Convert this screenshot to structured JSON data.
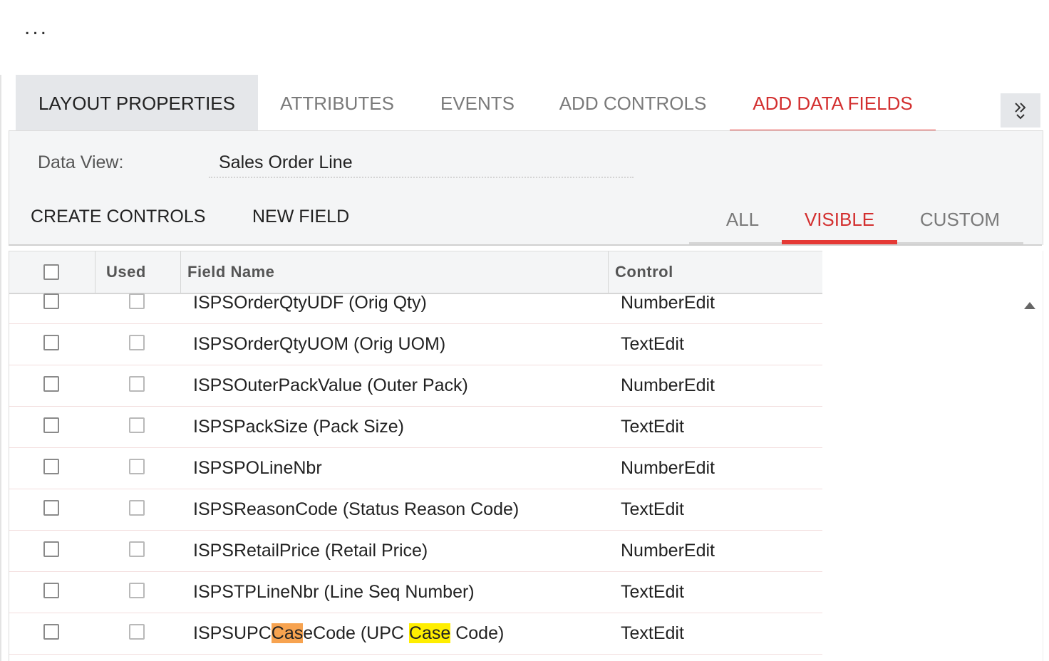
{
  "header": {
    "more_menu": "..."
  },
  "tabs": [
    {
      "label": "LAYOUT PROPERTIES"
    },
    {
      "label": "ATTRIBUTES"
    },
    {
      "label": "EVENTS"
    },
    {
      "label": "ADD CONTROLS"
    },
    {
      "label": "ADD DATA FIELDS"
    }
  ],
  "expand_icon": "double-chevron-icon",
  "data_view": {
    "label": "Data View:",
    "value": "Sales Order Line"
  },
  "actions": {
    "create_controls": "CREATE CONTROLS",
    "new_field": "NEW FIELD"
  },
  "filter_tabs": [
    {
      "label": "ALL"
    },
    {
      "label": "VISIBLE"
    },
    {
      "label": "CUSTOM"
    }
  ],
  "grid": {
    "columns": {
      "used": "Used",
      "field_name": "Field Name",
      "control": "Control"
    },
    "rows": [
      {
        "name": "ISPSOrderQtyUDF (Orig Qty)",
        "control": "NumberEdit"
      },
      {
        "name": "ISPSOrderQtyUOM (Orig UOM)",
        "control": "TextEdit"
      },
      {
        "name": "ISPSOuterPackValue (Outer Pack)",
        "control": "NumberEdit"
      },
      {
        "name": "ISPSPackSize (Pack Size)",
        "control": "TextEdit"
      },
      {
        "name": "ISPSPOLineNbr",
        "control": "NumberEdit"
      },
      {
        "name": "ISPSReasonCode (Status Reason Code)",
        "control": "TextEdit"
      },
      {
        "name": "ISPSRetailPrice (Retail Price)",
        "control": "NumberEdit"
      },
      {
        "name": "ISPSTPLineNbr (Line Seq Number)",
        "control": "TextEdit"
      },
      {
        "name_parts": [
          "ISPSUPC",
          "Cas",
          "eCode (UPC ",
          "Case",
          " Code)"
        ],
        "control": "TextEdit"
      }
    ]
  },
  "colors": {
    "accent": "#e53935",
    "search_current": "#f7a350",
    "search_match": "#ffee00"
  }
}
